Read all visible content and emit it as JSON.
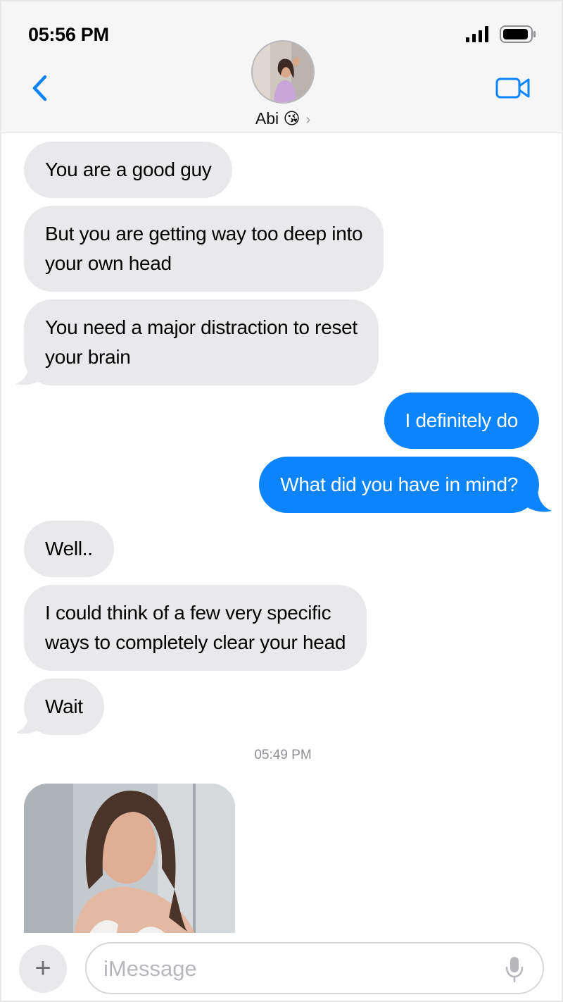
{
  "status_bar": {
    "time": "05:56 PM"
  },
  "header": {
    "contact_name": "Abi 😘",
    "chevron": "›"
  },
  "messages": [
    {
      "direction": "incoming",
      "lines": [
        "You are a good guy"
      ]
    },
    {
      "direction": "incoming",
      "lines": [
        "But you are getting way too deep into",
        "your own head"
      ]
    },
    {
      "direction": "incoming",
      "lines": [
        "You need a major distraction to reset",
        "your brain"
      ]
    },
    {
      "direction": "outgoing",
      "lines": [
        "I definitely do"
      ]
    },
    {
      "direction": "outgoing",
      "lines": [
        "What did you have in mind?"
      ]
    },
    {
      "direction": "incoming",
      "lines": [
        "Well.."
      ]
    },
    {
      "direction": "incoming",
      "lines": [
        "I could think of a few very specific",
        "ways to completely clear your head"
      ]
    },
    {
      "direction": "incoming",
      "lines": [
        "Wait"
      ]
    }
  ],
  "timestamp": "05:49 PM",
  "composer": {
    "plus": "+",
    "placeholder": "iMessage"
  },
  "icons": {
    "back": "chevron-left-icon",
    "video": "video-camera-icon",
    "signal": "cellular-signal-icon",
    "battery": "battery-icon",
    "mic": "microphone-icon"
  },
  "colors": {
    "accent": "#0b84fe",
    "incoming_bubble": "#e9e9eb",
    "header_bg": "#f6f6f6"
  }
}
